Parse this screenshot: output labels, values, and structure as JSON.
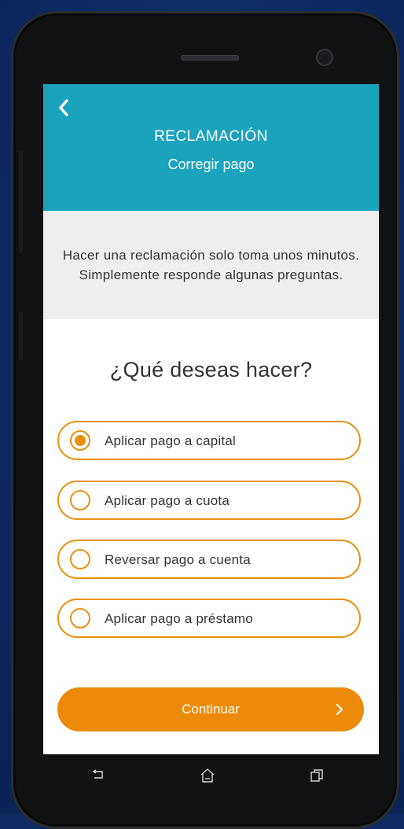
{
  "header": {
    "title": "RECLAMACIÓN",
    "subtitle": "Corregir pago"
  },
  "info": {
    "text": "Hacer una reclamación solo toma unos minutos. Simplemente responde algunas preguntas."
  },
  "question": "¿Qué deseas hacer?",
  "options": [
    {
      "label": "Aplicar pago a capital",
      "selected": true
    },
    {
      "label": "Aplicar pago a cuota",
      "selected": false
    },
    {
      "label": "Reversar pago a cuenta",
      "selected": false
    },
    {
      "label": "Aplicar pago a préstamo",
      "selected": false
    }
  ],
  "continue_button": {
    "label": "Continuar"
  },
  "colors": {
    "header": "#1ba3bd",
    "accent": "#ec8a0b",
    "background": "#0d2a63"
  },
  "icons": {
    "back": "chevron-left-icon",
    "continue": "chevron-right-icon",
    "nav_back": "back-icon",
    "nav_home": "home-icon",
    "nav_recents": "recents-icon"
  }
}
